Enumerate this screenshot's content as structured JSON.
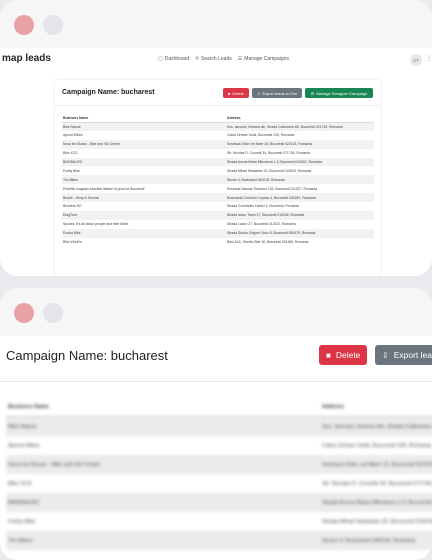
{
  "app": {
    "brand": "map leads",
    "nav": [
      {
        "icon": "dashboard-icon",
        "glyph": "▢",
        "label": "Dashboard"
      },
      {
        "icon": "search-icon",
        "glyph": "⚲",
        "label": "Search Leads"
      },
      {
        "icon": "list-icon",
        "glyph": "☰",
        "label": "Manage Campaigns"
      }
    ],
    "avatar_initials": "CT",
    "more_glyph": "⋮"
  },
  "campaign": {
    "title": "Campaign Name: bucharest",
    "buttons": {
      "delete": "Delete",
      "export": "Export leads to Csv",
      "manage": "Manage Scrapper Campaign"
    },
    "big_buttons": {
      "delete": "Delete",
      "export": "Export leads"
    }
  },
  "table": {
    "headers": [
      "Business Name",
      "Address"
    ],
    "rows": [
      [
        "Bike Nature",
        "Sos. Iancului, intrarea din, Strada Cutitoarea 4B, Bucuresti 021738, Romania"
      ],
      [
        "Aprowi Bikes",
        "Calea Zerban Vodă, Bucuresti 230, Romania"
      ],
      [
        "Nova len Buzau - Bike and Ski Center",
        "Soseaua Drilor cel Mare 15, Bucuresti 022103, Romania"
      ],
      [
        "Bike XCS",
        "Str. Nicolae D. Cocorăt 34, Bucuresti 071706, Romania"
      ],
      [
        "BIKEBALRO",
        "Strada Ancna Maria Mitrodova 1-3, Bucuresti 010802, Romania"
      ],
      [
        "Funky Bike",
        "Strada Mihail Sebastian 20, Bucuresti 010518, Romania"
      ],
      [
        "Tiro Bikes",
        "Sector 4, Bucharest 040018, Romania"
      ],
      [
        "Proiettic magazin biciclete afaceri si prod tor Bucuresti",
        "Soseaua Nicolae Titulescu 133, Bucuresti 011027, Romania"
      ],
      [
        "Bicicle - Shop & Service",
        "Bulevardul Corneliu Coposu 4, Bucuresti 030261, Romania"
      ],
      [
        "Bicicleta RO",
        "Strada Constantin Daniel 4, Bucuresti, Romania"
      ],
      [
        "DiagTone",
        "Strada Iancu Trans 17, Bucuresti 010046, Romania"
      ],
      [
        "Spokes. It's all about people and their bikes",
        "Strada Lacior 27, Bucuresti 012022, Romania"
      ],
      [
        "Doctor Bike",
        "Strada Doctor Grigore Sovo 8, Bucuresti 050475, Romania"
      ],
      [
        "Bike World's",
        "Bdul A40, Oberlin Blaf 18, Bucuresti 061186, Romania"
      ]
    ]
  },
  "colors": {
    "danger": "#dc3545",
    "secondary": "#6c757d",
    "success": "#198754",
    "window_dot_red": "#e8a0a5",
    "window_dot_gray": "#e3e5ea"
  }
}
